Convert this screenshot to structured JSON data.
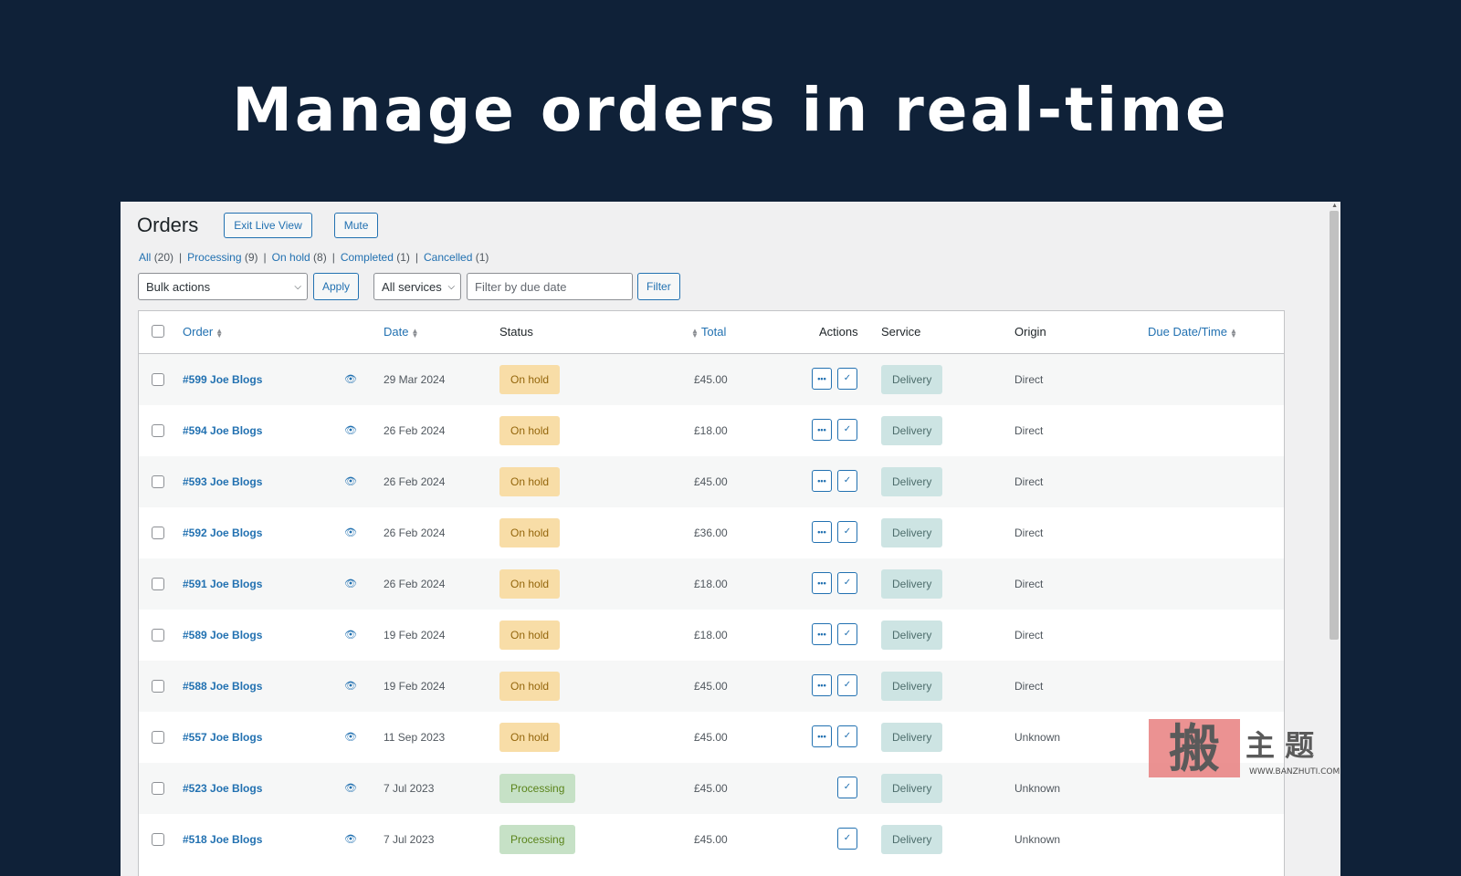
{
  "hero": {
    "title": "Manage orders in real-time"
  },
  "header": {
    "title": "Orders",
    "exit_live_view": "Exit Live View",
    "mute": "Mute"
  },
  "views": [
    {
      "label": "All",
      "count": "(20)"
    },
    {
      "label": "Processing",
      "count": "(9)"
    },
    {
      "label": "On hold",
      "count": "(8)"
    },
    {
      "label": "Completed",
      "count": "(1)"
    },
    {
      "label": "Cancelled",
      "count": "(1)"
    }
  ],
  "filters": {
    "bulk_actions": "Bulk actions",
    "apply": "Apply",
    "services": "All services",
    "due_date_placeholder": "Filter by due date",
    "filter": "Filter"
  },
  "columns": {
    "order": "Order",
    "date": "Date",
    "status": "Status",
    "total": "Total",
    "actions": "Actions",
    "service": "Service",
    "origin": "Origin",
    "due": "Due Date/Time"
  },
  "rows": [
    {
      "order": "#599 Joe Blogs",
      "date": "29 Mar 2024",
      "status": "On hold",
      "status_type": "hold",
      "total": "£45.00",
      "service": "Delivery",
      "origin": "Direct",
      "more_action": true
    },
    {
      "order": "#594 Joe Blogs",
      "date": "26 Feb 2024",
      "status": "On hold",
      "status_type": "hold",
      "total": "£18.00",
      "service": "Delivery",
      "origin": "Direct",
      "more_action": true
    },
    {
      "order": "#593 Joe Blogs",
      "date": "26 Feb 2024",
      "status": "On hold",
      "status_type": "hold",
      "total": "£45.00",
      "service": "Delivery",
      "origin": "Direct",
      "more_action": true
    },
    {
      "order": "#592 Joe Blogs",
      "date": "26 Feb 2024",
      "status": "On hold",
      "status_type": "hold",
      "total": "£36.00",
      "service": "Delivery",
      "origin": "Direct",
      "more_action": true
    },
    {
      "order": "#591 Joe Blogs",
      "date": "26 Feb 2024",
      "status": "On hold",
      "status_type": "hold",
      "total": "£18.00",
      "service": "Delivery",
      "origin": "Direct",
      "more_action": true
    },
    {
      "order": "#589 Joe Blogs",
      "date": "19 Feb 2024",
      "status": "On hold",
      "status_type": "hold",
      "total": "£18.00",
      "service": "Delivery",
      "origin": "Direct",
      "more_action": true
    },
    {
      "order": "#588 Joe Blogs",
      "date": "19 Feb 2024",
      "status": "On hold",
      "status_type": "hold",
      "total": "£45.00",
      "service": "Delivery",
      "origin": "Direct",
      "more_action": true
    },
    {
      "order": "#557 Joe Blogs",
      "date": "11 Sep 2023",
      "status": "On hold",
      "status_type": "hold",
      "total": "£45.00",
      "service": "Delivery",
      "origin": "Unknown",
      "more_action": true
    },
    {
      "order": "#523 Joe Blogs",
      "date": "7 Jul 2023",
      "status": "Processing",
      "status_type": "processing",
      "total": "£45.00",
      "service": "Delivery",
      "origin": "Unknown",
      "more_action": false
    },
    {
      "order": "#518 Joe Blogs",
      "date": "7 Jul 2023",
      "status": "Processing",
      "status_type": "processing",
      "total": "£45.00",
      "service": "Delivery",
      "origin": "Unknown",
      "more_action": false
    }
  ],
  "icons": {
    "eye": "eye-icon",
    "more": "ellipsis-icon",
    "complete": "checkmark-icon",
    "sort": "sort-arrows-icon",
    "dropdown": "chevron-down-icon"
  },
  "colors": {
    "background": "#0f2138",
    "accent": "#2271b1",
    "on_hold": "#f8dda7",
    "processing": "#c6e1c6",
    "service": "#cde4e3"
  },
  "watermark": {
    "glyph": "搬",
    "text": "主 题",
    "url": "WWW.BANZHUTI.COM"
  }
}
